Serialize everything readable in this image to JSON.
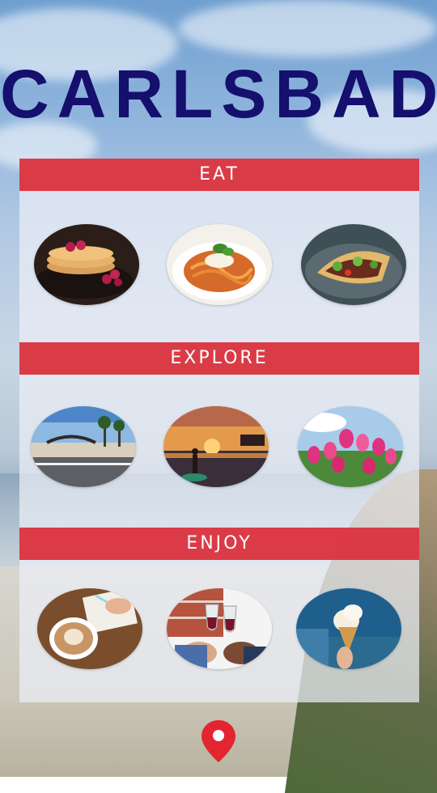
{
  "header": {
    "title": "CARLSBAD"
  },
  "sections": [
    {
      "label": "EAT",
      "items": [
        "pancakes-photo",
        "pasta-photo",
        "tacos-photo"
      ]
    },
    {
      "label": "EXPLORE",
      "items": [
        "village-arch-photo",
        "paddleboard-sunset-photo",
        "tulips-photo"
      ]
    },
    {
      "label": "ENJOY",
      "items": [
        "latte-photo",
        "wine-toast-photo",
        "ice-cream-photo"
      ]
    }
  ],
  "colors": {
    "title": "#150f6e",
    "band": "#d92e3a",
    "pin": "#e3252f"
  },
  "icons": {
    "map_pin": "map-pin-icon"
  }
}
